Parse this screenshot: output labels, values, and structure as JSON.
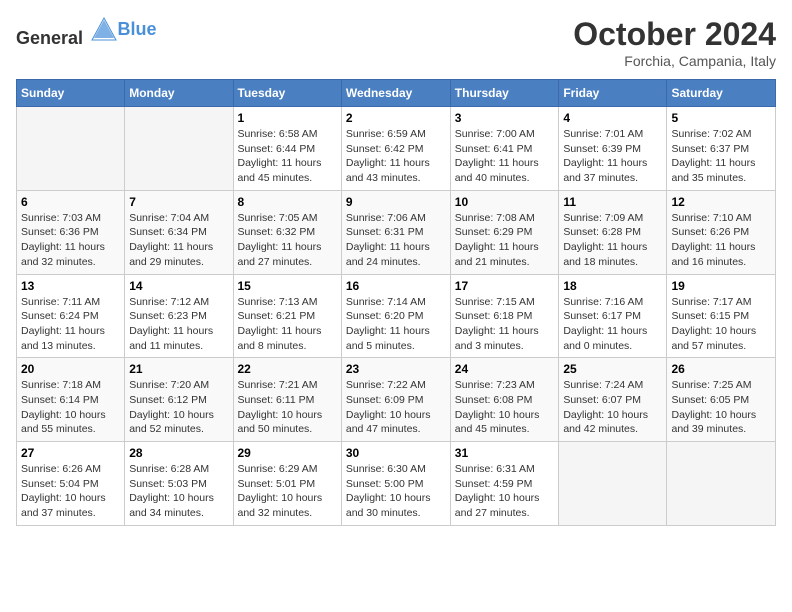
{
  "header": {
    "logo_general": "General",
    "logo_blue": "Blue",
    "month_title": "October 2024",
    "subtitle": "Forchia, Campania, Italy"
  },
  "days_of_week": [
    "Sunday",
    "Monday",
    "Tuesday",
    "Wednesday",
    "Thursday",
    "Friday",
    "Saturday"
  ],
  "weeks": [
    [
      {
        "day": "",
        "details": ""
      },
      {
        "day": "",
        "details": ""
      },
      {
        "day": "1",
        "details": "Sunrise: 6:58 AM\nSunset: 6:44 PM\nDaylight: 11 hours and 45 minutes."
      },
      {
        "day": "2",
        "details": "Sunrise: 6:59 AM\nSunset: 6:42 PM\nDaylight: 11 hours and 43 minutes."
      },
      {
        "day": "3",
        "details": "Sunrise: 7:00 AM\nSunset: 6:41 PM\nDaylight: 11 hours and 40 minutes."
      },
      {
        "day": "4",
        "details": "Sunrise: 7:01 AM\nSunset: 6:39 PM\nDaylight: 11 hours and 37 minutes."
      },
      {
        "day": "5",
        "details": "Sunrise: 7:02 AM\nSunset: 6:37 PM\nDaylight: 11 hours and 35 minutes."
      }
    ],
    [
      {
        "day": "6",
        "details": "Sunrise: 7:03 AM\nSunset: 6:36 PM\nDaylight: 11 hours and 32 minutes."
      },
      {
        "day": "7",
        "details": "Sunrise: 7:04 AM\nSunset: 6:34 PM\nDaylight: 11 hours and 29 minutes."
      },
      {
        "day": "8",
        "details": "Sunrise: 7:05 AM\nSunset: 6:32 PM\nDaylight: 11 hours and 27 minutes."
      },
      {
        "day": "9",
        "details": "Sunrise: 7:06 AM\nSunset: 6:31 PM\nDaylight: 11 hours and 24 minutes."
      },
      {
        "day": "10",
        "details": "Sunrise: 7:08 AM\nSunset: 6:29 PM\nDaylight: 11 hours and 21 minutes."
      },
      {
        "day": "11",
        "details": "Sunrise: 7:09 AM\nSunset: 6:28 PM\nDaylight: 11 hours and 18 minutes."
      },
      {
        "day": "12",
        "details": "Sunrise: 7:10 AM\nSunset: 6:26 PM\nDaylight: 11 hours and 16 minutes."
      }
    ],
    [
      {
        "day": "13",
        "details": "Sunrise: 7:11 AM\nSunset: 6:24 PM\nDaylight: 11 hours and 13 minutes."
      },
      {
        "day": "14",
        "details": "Sunrise: 7:12 AM\nSunset: 6:23 PM\nDaylight: 11 hours and 11 minutes."
      },
      {
        "day": "15",
        "details": "Sunrise: 7:13 AM\nSunset: 6:21 PM\nDaylight: 11 hours and 8 minutes."
      },
      {
        "day": "16",
        "details": "Sunrise: 7:14 AM\nSunset: 6:20 PM\nDaylight: 11 hours and 5 minutes."
      },
      {
        "day": "17",
        "details": "Sunrise: 7:15 AM\nSunset: 6:18 PM\nDaylight: 11 hours and 3 minutes."
      },
      {
        "day": "18",
        "details": "Sunrise: 7:16 AM\nSunset: 6:17 PM\nDaylight: 11 hours and 0 minutes."
      },
      {
        "day": "19",
        "details": "Sunrise: 7:17 AM\nSunset: 6:15 PM\nDaylight: 10 hours and 57 minutes."
      }
    ],
    [
      {
        "day": "20",
        "details": "Sunrise: 7:18 AM\nSunset: 6:14 PM\nDaylight: 10 hours and 55 minutes."
      },
      {
        "day": "21",
        "details": "Sunrise: 7:20 AM\nSunset: 6:12 PM\nDaylight: 10 hours and 52 minutes."
      },
      {
        "day": "22",
        "details": "Sunrise: 7:21 AM\nSunset: 6:11 PM\nDaylight: 10 hours and 50 minutes."
      },
      {
        "day": "23",
        "details": "Sunrise: 7:22 AM\nSunset: 6:09 PM\nDaylight: 10 hours and 47 minutes."
      },
      {
        "day": "24",
        "details": "Sunrise: 7:23 AM\nSunset: 6:08 PM\nDaylight: 10 hours and 45 minutes."
      },
      {
        "day": "25",
        "details": "Sunrise: 7:24 AM\nSunset: 6:07 PM\nDaylight: 10 hours and 42 minutes."
      },
      {
        "day": "26",
        "details": "Sunrise: 7:25 AM\nSunset: 6:05 PM\nDaylight: 10 hours and 39 minutes."
      }
    ],
    [
      {
        "day": "27",
        "details": "Sunrise: 6:26 AM\nSunset: 5:04 PM\nDaylight: 10 hours and 37 minutes."
      },
      {
        "day": "28",
        "details": "Sunrise: 6:28 AM\nSunset: 5:03 PM\nDaylight: 10 hours and 34 minutes."
      },
      {
        "day": "29",
        "details": "Sunrise: 6:29 AM\nSunset: 5:01 PM\nDaylight: 10 hours and 32 minutes."
      },
      {
        "day": "30",
        "details": "Sunrise: 6:30 AM\nSunset: 5:00 PM\nDaylight: 10 hours and 30 minutes."
      },
      {
        "day": "31",
        "details": "Sunrise: 6:31 AM\nSunset: 4:59 PM\nDaylight: 10 hours and 27 minutes."
      },
      {
        "day": "",
        "details": ""
      },
      {
        "day": "",
        "details": ""
      }
    ]
  ]
}
